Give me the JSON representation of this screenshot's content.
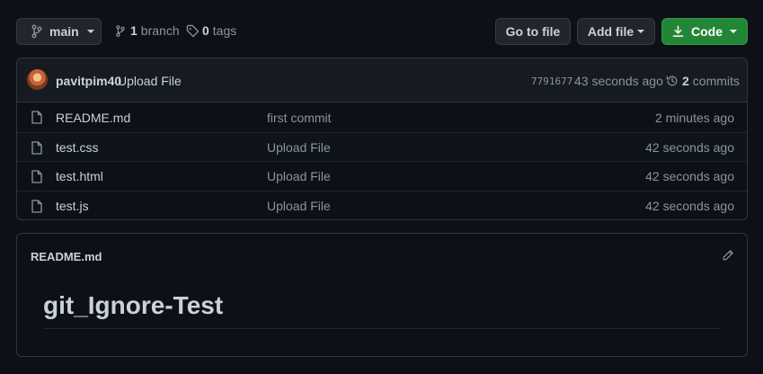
{
  "toolbar": {
    "branch_button": "main",
    "branch_count": "1",
    "branch_label": "branch",
    "tag_count": "0",
    "tag_label": "tags",
    "go_to_file": "Go to file",
    "add_file": "Add file",
    "code": "Code"
  },
  "commit": {
    "author": "pavitpim40",
    "message": "Upload File",
    "sha": "7791677",
    "time": "43 seconds ago",
    "commit_count": "2",
    "commit_label": "commits"
  },
  "files": [
    {
      "name": "README.md",
      "message": "first commit",
      "time": "2 minutes ago"
    },
    {
      "name": "test.css",
      "message": "Upload File",
      "time": "42 seconds ago"
    },
    {
      "name": "test.html",
      "message": "Upload File",
      "time": "42 seconds ago"
    },
    {
      "name": "test.js",
      "message": "Upload File",
      "time": "42 seconds ago"
    }
  ],
  "readme": {
    "filename": "README.md",
    "heading": "git_Ignore-Test"
  },
  "colors": {
    "background": "#0d1117",
    "code_button": "#238636",
    "border": "#30363d"
  }
}
